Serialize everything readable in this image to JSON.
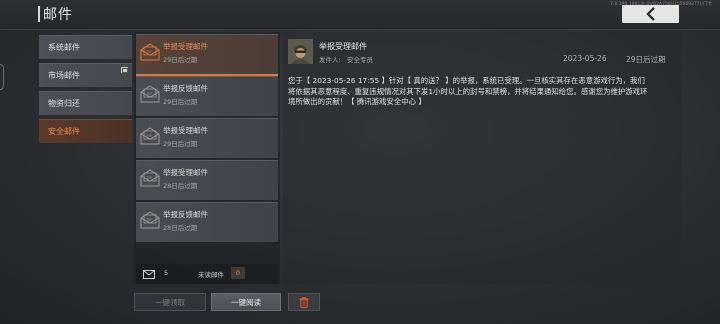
{
  "header": {
    "title": "邮件",
    "version_info": "7.0.190.19913(-0)/Q2A756/(155669277)/门卡",
    "back_icon": "chevron-left-icon"
  },
  "sidebar": {
    "items": [
      {
        "label": "系统邮件",
        "active": false
      },
      {
        "label": "市场邮件",
        "active": false,
        "badge_icon": "mail-badge-icon"
      },
      {
        "label": "物资归还",
        "active": false
      },
      {
        "label": "安全邮件",
        "active": true
      }
    ]
  },
  "mail_list": {
    "items": [
      {
        "title": "举报受理邮件",
        "expiry": "29日后过期",
        "selected": true
      },
      {
        "title": "举报反馈邮件",
        "expiry": "29日后过期",
        "selected": false
      },
      {
        "title": "举报受理邮件",
        "expiry": "29日后过期",
        "selected": false
      },
      {
        "title": "举报受理邮件",
        "expiry": "28日后过期",
        "selected": false
      },
      {
        "title": "举报反馈邮件",
        "expiry": "28日后过期",
        "selected": false
      }
    ]
  },
  "unread": {
    "count": "5",
    "label": "未读邮件",
    "unread_num": "0"
  },
  "actions": {
    "collect_all": "一键领取",
    "read_all": "一键阅读",
    "delete_icon": "trash-icon"
  },
  "detail": {
    "title": "举报受理邮件",
    "sender_label": "发件人:",
    "sender": "安全专员",
    "date": "2023-05-26",
    "expiry": "29日后过期",
    "body": "您于【 2023-05-26 17:55 】针对【 真的送？ 】的举报，系统已受理。一旦核实其存在恶意游戏行为，我们将依据其恶意程度、重复违规情况对其下发1小时以上的封号和禁榜，并将结果通知给您。感谢您为维护游戏环境所做出的贡献！【 腾讯游戏安全中心 】"
  },
  "colors": {
    "accent": "#f08a52",
    "accent_line": "#e07a3c",
    "delete": "#e0522f"
  }
}
